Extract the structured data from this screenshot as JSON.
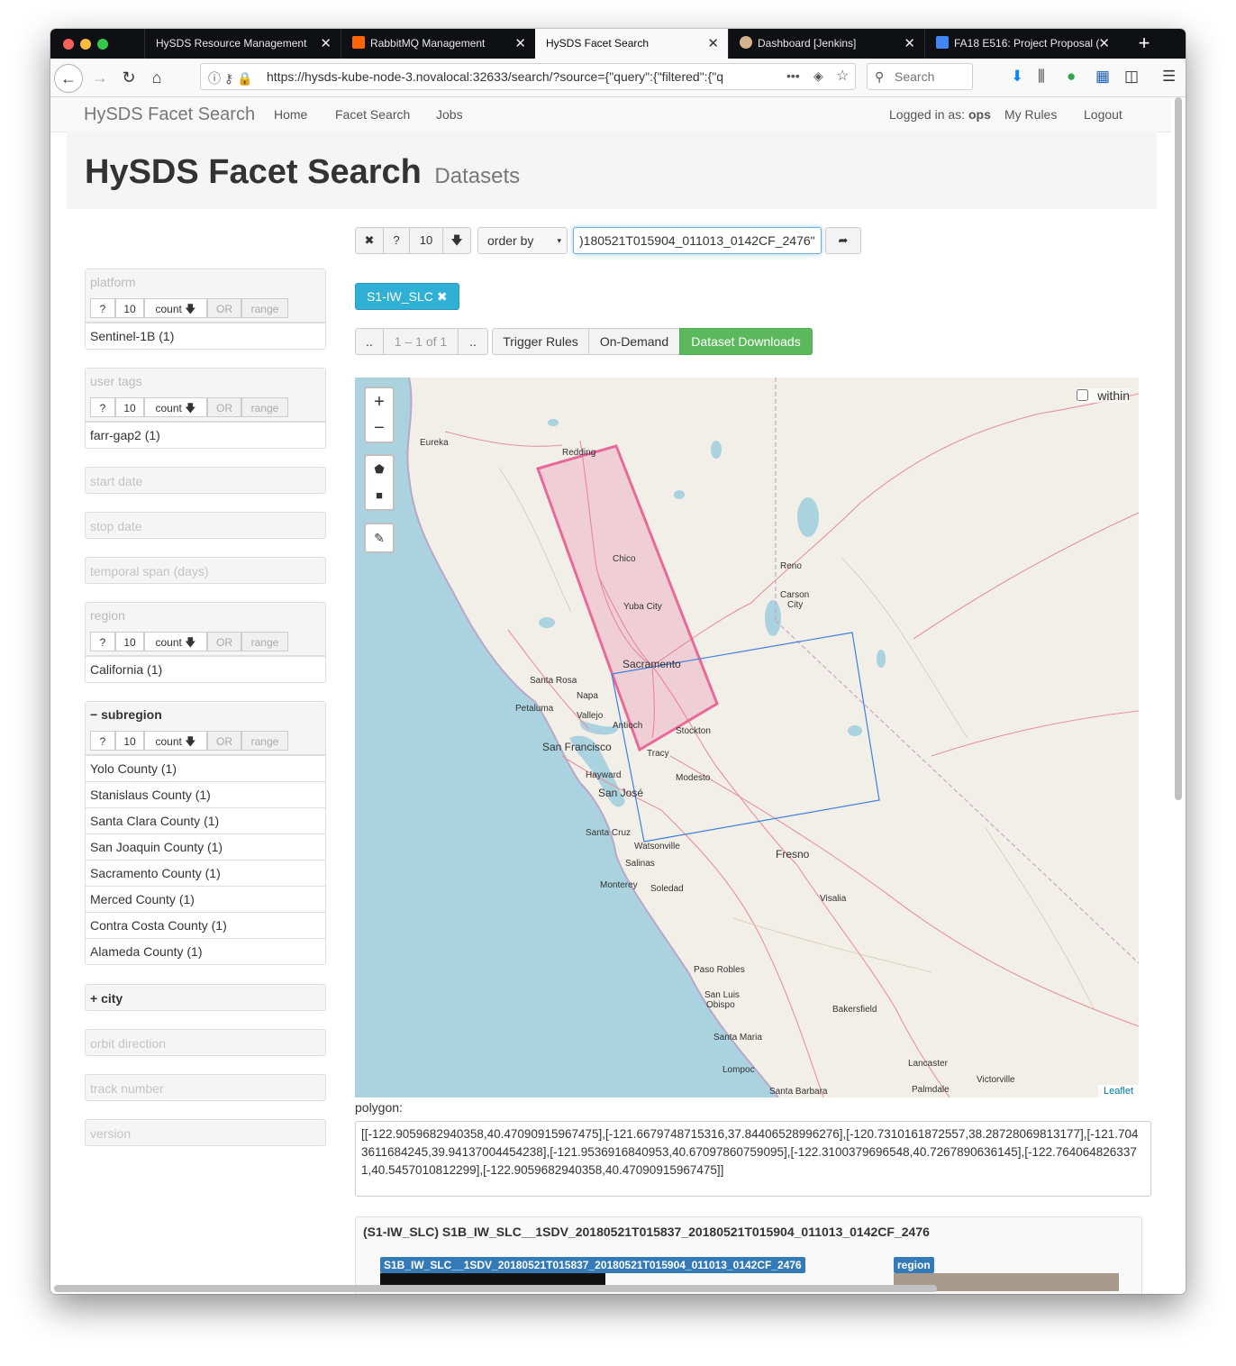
{
  "browser": {
    "tabs": [
      {
        "label": "HySDS Resource Management",
        "active": false
      },
      {
        "label": "RabbitMQ Management",
        "active": false
      },
      {
        "label": "HySDS Facet Search",
        "active": true
      },
      {
        "label": "Dashboard [Jenkins]",
        "active": false
      },
      {
        "label": "FA18 E516: Project Proposal (",
        "active": false
      }
    ],
    "url": "https://hysds-kube-node-3.novalocal:32633/search/?source={\"query\":{\"filtered\":{\"q",
    "search_placeholder": "Search",
    "new_tab": "+",
    "close": "✕"
  },
  "app_nav": {
    "brand": "HySDS Facet Search",
    "links": [
      "Home",
      "Facet Search",
      "Jobs"
    ],
    "logged_in_prefix": "Logged in as:",
    "user": "ops",
    "my_rules": "My Rules",
    "logout": "Logout"
  },
  "header": {
    "title": "HySDS Facet Search",
    "subtitle": "Datasets"
  },
  "facet_controls": {
    "help": "?",
    "size": "10",
    "count": "count",
    "or": "OR",
    "range": "range"
  },
  "facets": {
    "platform": {
      "title": "platform",
      "items": [
        "Sentinel-1B (1)"
      ]
    },
    "user_tags": {
      "title": "user tags",
      "items": [
        "farr-gap2 (1)"
      ]
    },
    "start_date": "start date",
    "stop_date": "stop date",
    "temporal_span": "temporal span (days)",
    "region": {
      "title": "region",
      "items": [
        "California (1)"
      ]
    },
    "subregion": {
      "title": "subregion",
      "items": [
        "Yolo County (1)",
        "Stanislaus County (1)",
        "Santa Clara County (1)",
        "San Joaquin County (1)",
        "Sacramento County (1)",
        "Merced County (1)",
        "Contra Costa County (1)",
        "Alameda County (1)"
      ]
    },
    "city": "city",
    "orbit_direction": "orbit direction",
    "track_number": "track number",
    "version": "version"
  },
  "toolbar": {
    "clear": "✖",
    "help": "?",
    "page_size": "10",
    "order_by": "order by",
    "query_value": ")180521T015904_011013_0142CF_2476\"",
    "go": "➦"
  },
  "active_filter": {
    "label": "S1-IW_SLC",
    "remove": "✖"
  },
  "pager": {
    "prev": "..",
    "range": "1 – 1 of 1",
    "next": "..",
    "trigger_rules": "Trigger Rules",
    "on_demand": "On-Demand",
    "dataset_downloads": "Dataset Downloads"
  },
  "map": {
    "zoom_in": "+",
    "zoom_out": "−",
    "within_label": "within",
    "attribution": "Leaflet",
    "places": [
      "Eureka",
      "Redding",
      "Chico",
      "Yuba City",
      "Reno",
      "Carson City",
      "Sacramento",
      "Santa Rosa",
      "Napa",
      "Petaluma",
      "Vallejo",
      "Antioch",
      "Stockton",
      "San Francisco",
      "Tracy",
      "Hayward",
      "Modesto",
      "San José",
      "Santa Cruz",
      "Watsonville",
      "Fresno",
      "Salinas",
      "Monterey",
      "Soledad",
      "Visalia",
      "Paso Robles",
      "San Luis Obispo",
      "Bakersfield",
      "Santa Maria",
      "Lompoc",
      "Lancaster",
      "Victorville",
      "Palmdale",
      "Santa Barbara"
    ],
    "colors": {
      "water": "#aad3df",
      "land": "#f2efe9",
      "footprint": "#e86a9a",
      "bbox": "#3f7fe0"
    }
  },
  "polygon": {
    "label": "polygon:",
    "value": "[[-122.9059682940358,40.47090915967475],[-121.6679748715316,37.84406528996276],[-120.7310161872557,38.28728069813177],[-121.7043611684245,39.94137004454238],[-121.9536916840953,40.67097860759095],[-122.3100379696548,40.7267890636145],[-122.7640648263371,40.5457010812299],[-122.9059682940358,40.47090915967475]]"
  },
  "result": {
    "title": "(S1-IW_SLC) S1B_IW_SLC__1SDV_20180521T015837_20180521T015904_011013_0142CF_2476",
    "id_label": "S1B_IW_SLC__1SDV_20180521T015837_20180521T015904_011013_0142CF_2476",
    "region_label": "region"
  }
}
